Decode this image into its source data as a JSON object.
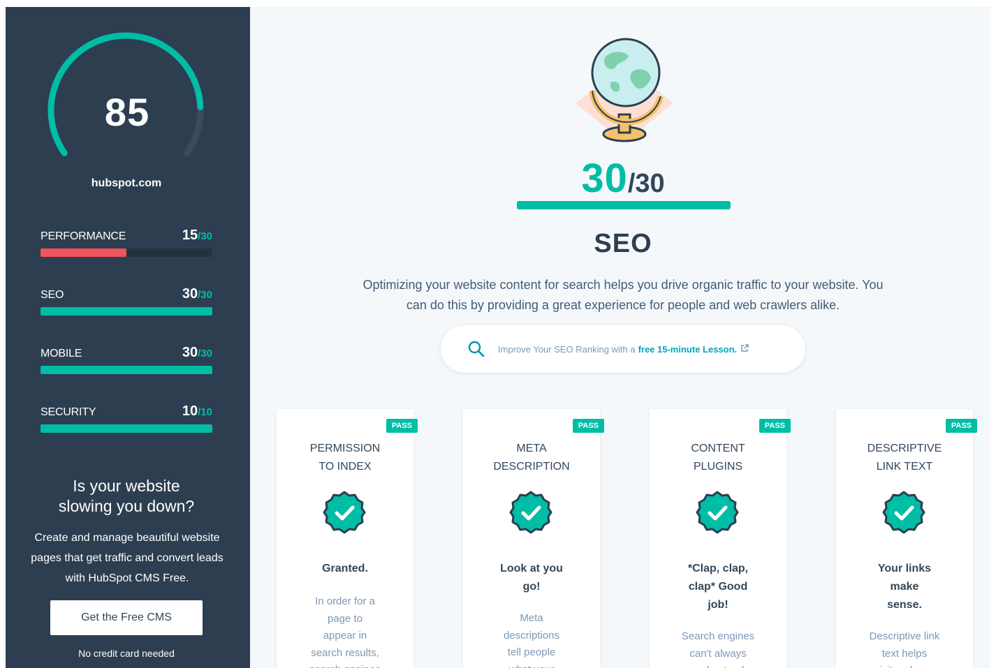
{
  "sidebar": {
    "overall_score": "85",
    "domain": "hubspot.com",
    "gauge_color": "#00bda5",
    "gauge_track_color": "#3c4b5b",
    "gauge_fraction": 0.85,
    "metrics": [
      {
        "label": "PERFORMANCE",
        "score": "15",
        "total": "/30",
        "fraction": 0.5,
        "color": "#f2545b"
      },
      {
        "label": "SEO",
        "score": "30",
        "total": "/30",
        "fraction": 1.0,
        "color": "#00bda5"
      },
      {
        "label": "MOBILE",
        "score": "30",
        "total": "/30",
        "fraction": 1.0,
        "color": "#00bda5"
      },
      {
        "label": "SECURITY",
        "score": "10",
        "total": "/10",
        "fraction": 1.0,
        "color": "#00bda5"
      }
    ],
    "promo": {
      "title_line1": "Is your website",
      "title_line2": "slowing you down?",
      "body_line1": "Create and manage beautiful website",
      "body_line2": "pages that get traffic and convert leads",
      "body_line3": "with HubSpot CMS Free.",
      "button_label": "Get the Free CMS",
      "note": "No credit card needed"
    }
  },
  "main": {
    "illustration_icon": "globe-icon",
    "score": "30",
    "total": "/30",
    "score_fraction": 1.0,
    "title": "SEO",
    "description_line1": "Optimizing your website content for search helps you drive organic traffic to your website. You",
    "description_line2": "can do this by providing a great experience for people and web crawlers alike.",
    "lesson": {
      "icon": "search-icon",
      "text": "Improve Your SEO Ranking with a",
      "link": "free 15-minute Lesson.",
      "link_icon": "external-link-icon"
    },
    "accent_color": "#00bda5",
    "cards": [
      {
        "badge": "PASS",
        "title_line1": "PERMISSION",
        "title_line2": "TO INDEX",
        "icon": "check-badge-icon",
        "headline_lines": [
          "Granted."
        ],
        "body_lines": [
          "In order for a",
          "page to",
          "appear in",
          "search results,",
          "search engines"
        ]
      },
      {
        "badge": "PASS",
        "title_line1": "META",
        "title_line2": "DESCRIPTION",
        "icon": "check-badge-icon",
        "headline_lines": [
          "Look at you",
          "go!"
        ],
        "body_lines": [
          "Meta",
          "descriptions",
          "tell people",
          "what your"
        ]
      },
      {
        "badge": "PASS",
        "title_line1": "CONTENT",
        "title_line2": "PLUGINS",
        "icon": "check-badge-icon",
        "headline_lines": [
          "*Clap, clap,",
          "clap* Good",
          "job!"
        ],
        "body_lines": [
          "Search engines",
          "can't always",
          "understand"
        ]
      },
      {
        "badge": "PASS",
        "title_line1": "DESCRIPTIVE",
        "title_line2": "LINK TEXT",
        "icon": "check-badge-icon",
        "headline_lines": [
          "Your links",
          "make",
          "sense."
        ],
        "body_lines": [
          "Descriptive link",
          "text helps",
          "visitors know"
        ]
      }
    ]
  }
}
